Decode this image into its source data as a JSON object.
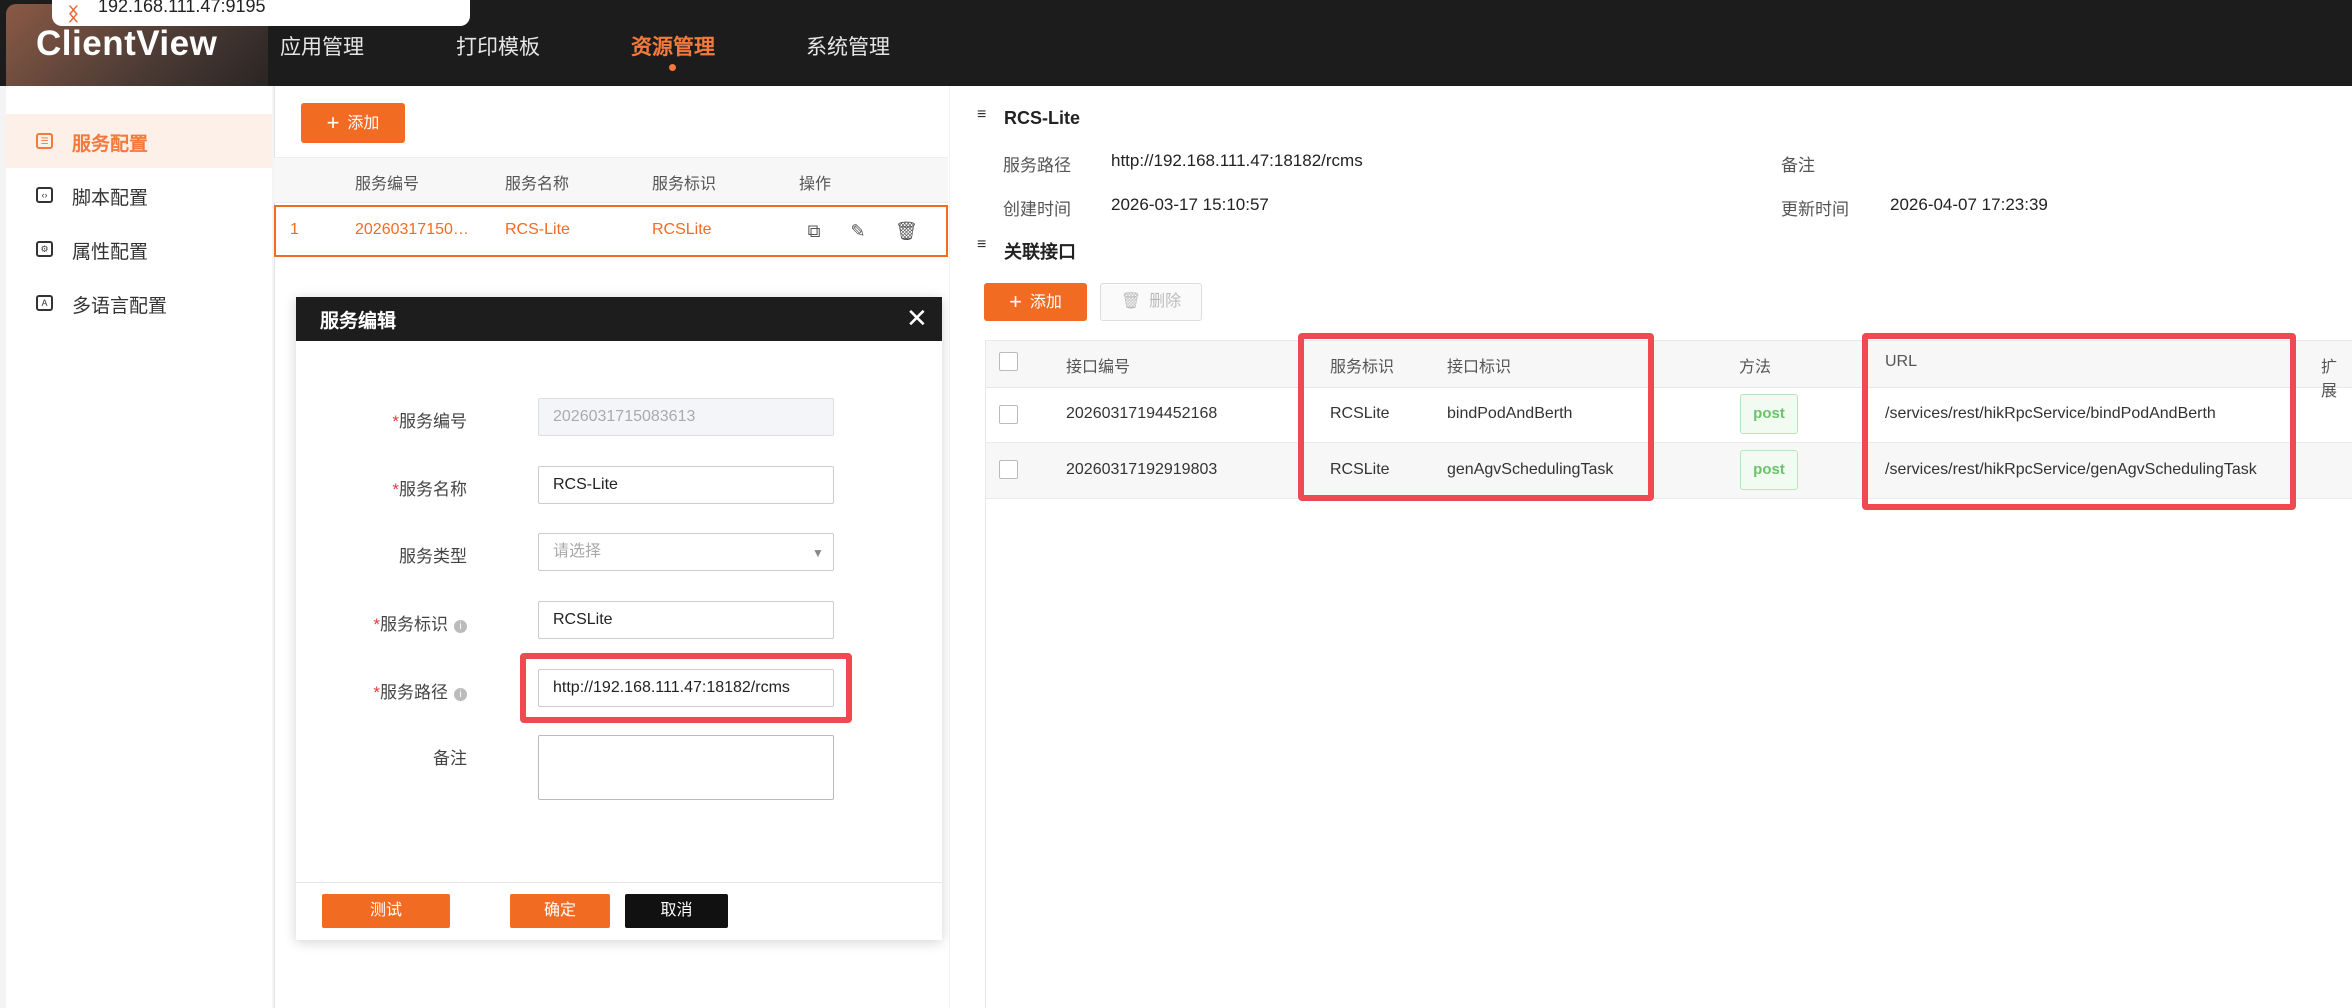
{
  "browser": {
    "address": "192.168.111.47:9195"
  },
  "app": {
    "brand": "ClientView",
    "nav": [
      "应用管理",
      "打印模板",
      "资源管理",
      "系统管理"
    ],
    "nav_active_index": 2
  },
  "sidebar": {
    "items": [
      {
        "label": "服务配置",
        "icon": "service-config-icon",
        "active": true
      },
      {
        "label": "脚本配置",
        "icon": "script-config-icon",
        "active": false
      },
      {
        "label": "属性配置",
        "icon": "property-config-icon",
        "active": false
      },
      {
        "label": "多语言配置",
        "icon": "language-config-icon",
        "active": false
      }
    ]
  },
  "service_list": {
    "add_label": "添加",
    "columns": [
      "服务编号",
      "服务名称",
      "服务标识",
      "操作"
    ],
    "rows": [
      {
        "index": "1",
        "id": "20260317150…",
        "name": "RCS-Lite",
        "identifier": "RCSLite"
      }
    ]
  },
  "dialog": {
    "title": "服务编辑",
    "fields": {
      "service_no": {
        "label": "服务编号",
        "value": "2026031715083613",
        "required": true
      },
      "service_name": {
        "label": "服务名称",
        "value": "RCS-Lite",
        "required": true
      },
      "service_type": {
        "label": "服务类型",
        "placeholder": "请选择",
        "required": false
      },
      "service_id": {
        "label": "服务标识",
        "value": "RCSLite",
        "required": true
      },
      "service_path": {
        "label": "服务路径",
        "value": "http://192.168.111.47:18182/rcms",
        "required": true
      },
      "remark": {
        "label": "备注",
        "value": ""
      }
    },
    "buttons": {
      "test": "测试",
      "confirm": "确定",
      "cancel": "取消"
    }
  },
  "detail": {
    "title": "RCS-Lite",
    "path_label": "服务路径",
    "path_value": "http://192.168.111.47:18182/rcms",
    "remark_label": "备注",
    "created_label": "创建时间",
    "created_value": "2026-03-17 15:10:57",
    "updated_label": "更新时间",
    "updated_value": "2026-04-07 17:23:39",
    "section_title": "关联接口",
    "add_label": "添加",
    "delete_label": "删除"
  },
  "interfaces": {
    "columns": [
      "接口编号",
      "服务标识",
      "接口标识",
      "方法",
      "URL",
      "扩展"
    ],
    "rows": [
      {
        "id": "20260317194452168",
        "service": "RCSLite",
        "interface": "bindPodAndBerth",
        "method": "post",
        "url": "/services/rest/hikRpcService/bindPodAndBerth"
      },
      {
        "id": "20260317192919803",
        "service": "RCSLite",
        "interface": "genAgvSchedulingTask",
        "method": "post",
        "url": "/services/rest/hikRpcService/genAgvSchedulingTask"
      }
    ]
  },
  "colors": {
    "accent": "#f26b23",
    "highlight": "#ef4a52",
    "header_bg": "#1c1c1c",
    "method_green": "#6cc36c"
  }
}
